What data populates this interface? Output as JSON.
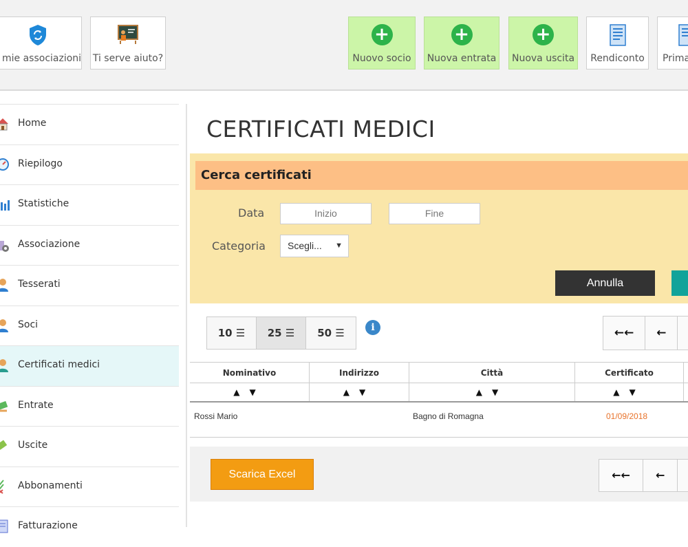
{
  "toolbar": {
    "my_associations": "mie associazioni",
    "help": "Ti serve aiuto?",
    "new_member": "Nuovo socio",
    "new_income": "Nuova entrata",
    "new_expense": "Nuova uscita",
    "report": "Rendiconto",
    "prima": "Prima"
  },
  "sidebar": {
    "items": [
      {
        "label": "Home",
        "icon": "house-icon"
      },
      {
        "label": "Riepilogo",
        "icon": "dashboard-icon"
      },
      {
        "label": "Statistiche",
        "icon": "chart-icon"
      },
      {
        "label": "Associazione",
        "icon": "building-gear-icon"
      },
      {
        "label": "Tesserati",
        "icon": "user-icon"
      },
      {
        "label": "Soci",
        "icon": "user-icon"
      },
      {
        "label": "Certificati medici",
        "icon": "user-icon"
      },
      {
        "label": "Entrate",
        "icon": "money-in-icon"
      },
      {
        "label": "Uscite",
        "icon": "money-out-icon"
      },
      {
        "label": "Abbonamenti",
        "icon": "checklist-icon"
      },
      {
        "label": "Fatturazione",
        "icon": "invoice-icon"
      }
    ],
    "active_index": 6
  },
  "page": {
    "title": "CERTIFICATI MEDICI"
  },
  "search": {
    "header": "Cerca certificati",
    "date_label": "Data",
    "start_placeholder": "Inizio",
    "end_placeholder": "Fine",
    "category_label": "Categoria",
    "category_value": "Scegli...",
    "cancel_label": "Annulla"
  },
  "pagination": {
    "page_sizes": [
      "10",
      "25",
      "50"
    ],
    "selected_size": "25",
    "first": "←←",
    "prev": "←"
  },
  "table": {
    "columns": [
      "Nominativo",
      "Indirizzo",
      "Città",
      "Certificato"
    ],
    "rows": [
      {
        "nominativo": "Rossi Mario",
        "indirizzo": "",
        "citta": "Bagno di Romagna",
        "certificato": "01/09/2018"
      }
    ]
  },
  "footer": {
    "excel_label": "Scarica Excel"
  },
  "colors": {
    "green_button": "#ccf5a8",
    "search_panel": "#fae6a9",
    "search_header": "#fdbf85",
    "excel_button": "#f39c12",
    "expired_date": "#e8722a",
    "active_sidebar": "#e5f7f8"
  }
}
